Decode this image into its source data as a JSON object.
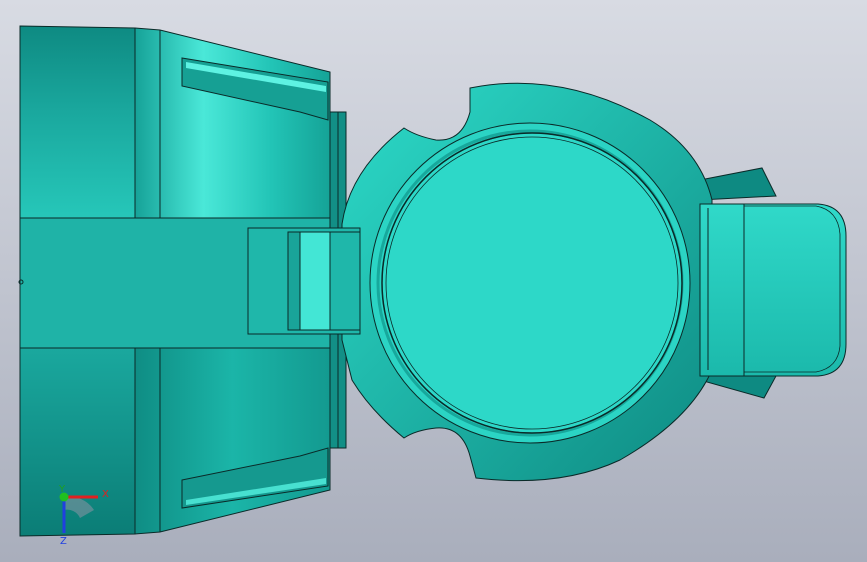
{
  "viewport": {
    "background_top": "#d9dce4",
    "background_bottom": "#a8adbb",
    "part_color": "#1fbfb0",
    "part_light": "#2ed8c8",
    "part_dark": "#0e8f86",
    "edge_color": "#0a2a28"
  },
  "triad": {
    "x_label": "X",
    "y_label": "Y",
    "z_label": "Z",
    "x_color": "#e02020",
    "y_color": "#20c020",
    "z_color": "#2040e0"
  }
}
